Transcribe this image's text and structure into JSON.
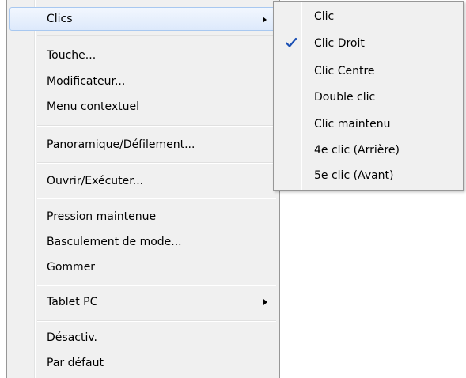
{
  "main_menu": {
    "items": [
      {
        "label": "Clics"
      },
      {
        "label": "Touche..."
      },
      {
        "label": "Modificateur..."
      },
      {
        "label": "Menu contextuel"
      },
      {
        "label": "Panoramique/Défilement..."
      },
      {
        "label": "Ouvrir/Exécuter..."
      },
      {
        "label": "Pression maintenue"
      },
      {
        "label": "Basculement de mode..."
      },
      {
        "label": "Gommer"
      },
      {
        "label": "Tablet PC"
      },
      {
        "label": "Désactiv."
      },
      {
        "label": "Par défaut"
      }
    ]
  },
  "submenu": {
    "items": [
      {
        "label": "Clic"
      },
      {
        "label": "Clic Droit",
        "checked": true
      },
      {
        "label": "Clic Centre"
      },
      {
        "label": "Double clic"
      },
      {
        "label": "Clic maintenu"
      },
      {
        "label": "4e clic (Arrière)"
      },
      {
        "label": "5e clic (Avant)"
      }
    ]
  },
  "colors": {
    "highlight_border": "#a8c8f0",
    "check_color": "#1a4fb4",
    "menu_background": "#f0f0f0"
  }
}
